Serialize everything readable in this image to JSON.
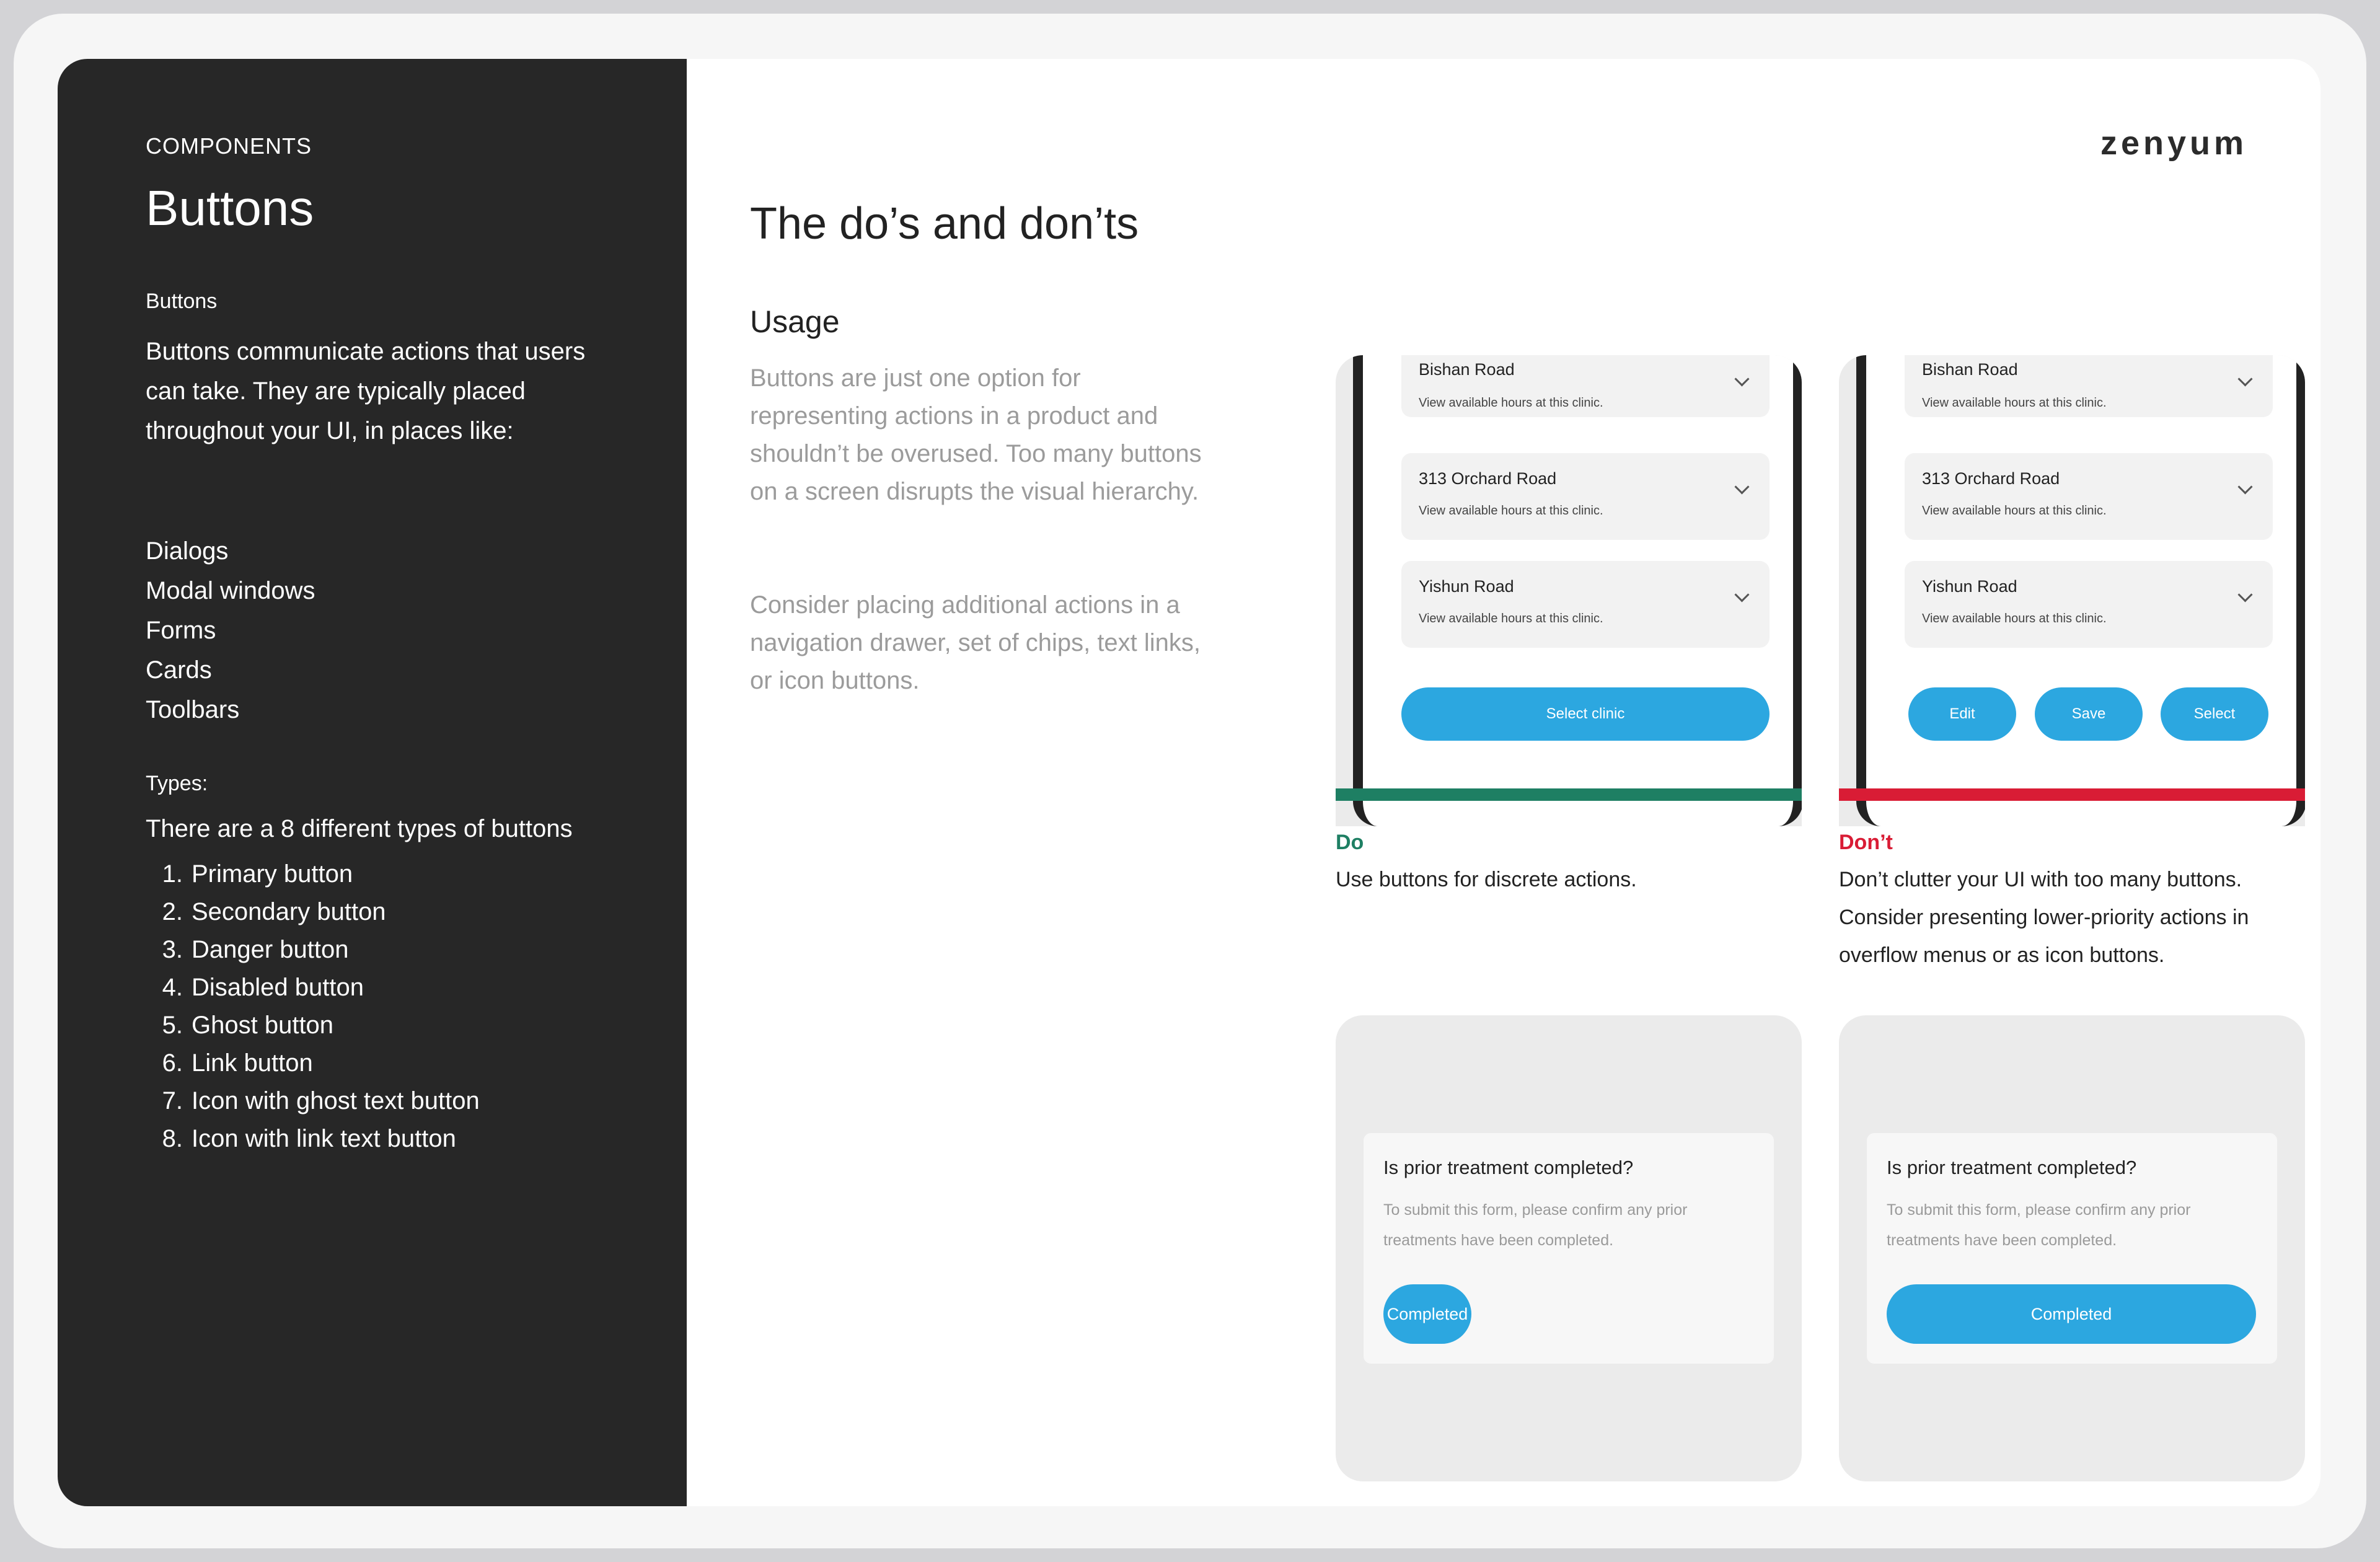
{
  "sidebar": {
    "eyebrow": "COMPONENTS",
    "title": "Buttons",
    "section_label": "Buttons",
    "description": "Buttons communicate actions that users can take. They are typically placed throughout your UI, in places like:",
    "places": [
      "Dialogs",
      "Modal windows",
      "Forms",
      "Cards",
      "Toolbars"
    ],
    "types_label": "Types:",
    "types_intro": "There are a 8 different types of buttons",
    "types": [
      {
        "num": "1.",
        "label": "Primary button"
      },
      {
        "num": "2.",
        "label": "Secondary button"
      },
      {
        "num": "3.",
        "label": "Danger button"
      },
      {
        "num": "4.",
        "label": "Disabled button"
      },
      {
        "num": "5.",
        "label": "Ghost button"
      },
      {
        "num": "6.",
        "label": "Link button"
      },
      {
        "num": "7.",
        "label": "Icon with ghost text button"
      },
      {
        "num": "8.",
        "label": "Icon with link text button"
      }
    ]
  },
  "main": {
    "logo": "zenyum",
    "title": "The do’s and don’ts",
    "usage_title": "Usage",
    "usage_p1": "Buttons are just one option for representing actions in a product and shouldn’t be overused. Too many buttons on a screen disrupts the visual hierarchy.",
    "usage_p2": "Consider placing additional actions in a navigation drawer, set of chips, text links, or icon buttons."
  },
  "clinic_list": {
    "items": [
      {
        "name": "Bishan Road",
        "sub": "View available hours at this clinic."
      },
      {
        "name": "313 Orchard Road",
        "sub": "View available hours at this clinic."
      },
      {
        "name": "Yishun Road",
        "sub": "View available hours at this clinic."
      }
    ]
  },
  "do_example": {
    "button_label": "Select clinic",
    "label": "Do",
    "text": "Use buttons for discrete actions.",
    "color": "#1e7f63"
  },
  "dont_example": {
    "buttons": [
      "Edit",
      "Save",
      "Select"
    ],
    "label": "Don’t",
    "text": "Don’t clutter your UI with too many buttons. Consider presenting lower-priority actions in overflow menus or as icon buttons.",
    "color": "#d91c35"
  },
  "dialog": {
    "title": "Is prior treatment completed?",
    "text": "To submit this form, please confirm any prior treatments have been completed.",
    "button_label": "Completed"
  },
  "colors": {
    "accent": "#2ca7e0",
    "sidebar_bg": "#272727"
  }
}
